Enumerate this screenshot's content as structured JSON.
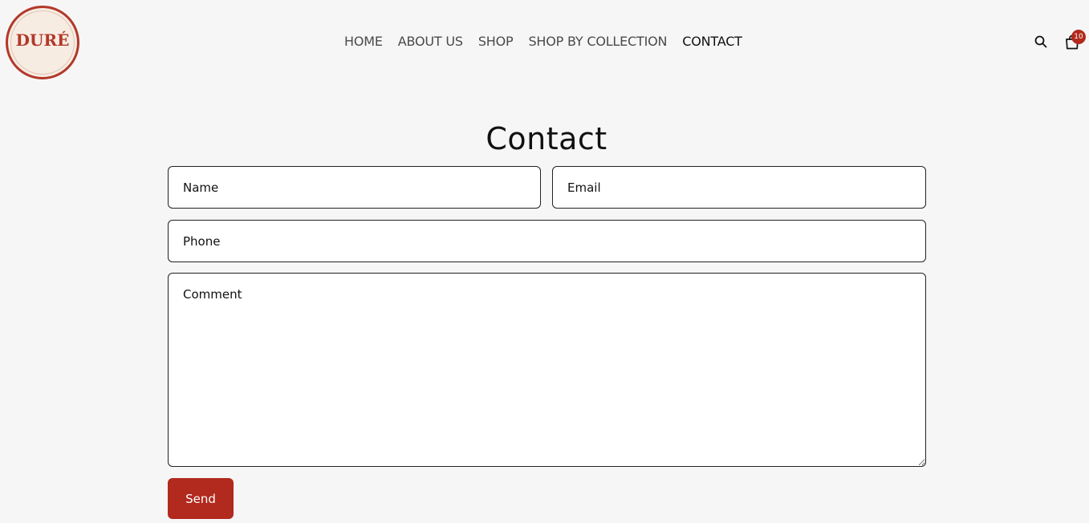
{
  "brand": {
    "logo_text": "DURÉ",
    "accent_color": "#b2291d"
  },
  "nav": {
    "items": [
      {
        "label": "HOME",
        "active": false
      },
      {
        "label": "ABOUT US",
        "active": false
      },
      {
        "label": "SHOP",
        "active": false
      },
      {
        "label": "SHOP BY COLLECTION",
        "active": false
      },
      {
        "label": "CONTACT",
        "active": true
      }
    ]
  },
  "header_icons": {
    "search_icon": "search-icon",
    "cart_icon": "shopping-bag-icon",
    "cart_count": "10"
  },
  "page": {
    "title": "Contact"
  },
  "form": {
    "name_placeholder": "Name",
    "email_placeholder": "Email",
    "phone_placeholder": "Phone",
    "comment_placeholder": "Comment",
    "submit_label": "Send"
  }
}
